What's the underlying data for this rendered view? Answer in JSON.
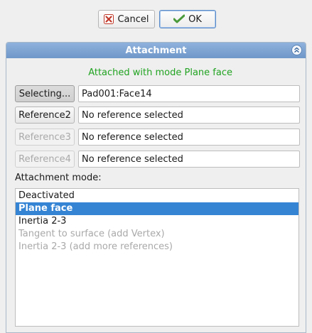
{
  "dialog": {
    "cancel_label": "Cancel",
    "ok_label": "OK"
  },
  "panel": {
    "title": "Attachment",
    "status": "Attached with mode Plane face"
  },
  "references": [
    {
      "button_label": "Selecting...",
      "value": "Pad001:Face14",
      "state": "active"
    },
    {
      "button_label": "Reference2",
      "value": "No reference selected",
      "state": "enabled"
    },
    {
      "button_label": "Reference3",
      "value": "No reference selected",
      "state": "disabled"
    },
    {
      "button_label": "Reference4",
      "value": "No reference selected",
      "state": "disabled"
    }
  ],
  "attachment_mode": {
    "label": "Attachment mode:",
    "items": [
      {
        "label": "Deactivated",
        "state": "normal"
      },
      {
        "label": "Plane face",
        "state": "selected"
      },
      {
        "label": "Inertia 2-3",
        "state": "normal"
      },
      {
        "label": "Tangent to surface (add Vertex)",
        "state": "disabled"
      },
      {
        "label": "Inertia 2-3 (add more references)",
        "state": "disabled"
      }
    ]
  },
  "colors": {
    "status_green": "#21a321",
    "header_blue": "#7aa0d0",
    "selection_blue": "#3584d4",
    "cancel_icon_red": "#c0392b",
    "ok_icon_green": "#4a9a3a"
  },
  "icons": {
    "cancel": "cancel-x-icon",
    "ok": "ok-check-icon",
    "collapse": "collapse-chevron-up-icon"
  }
}
